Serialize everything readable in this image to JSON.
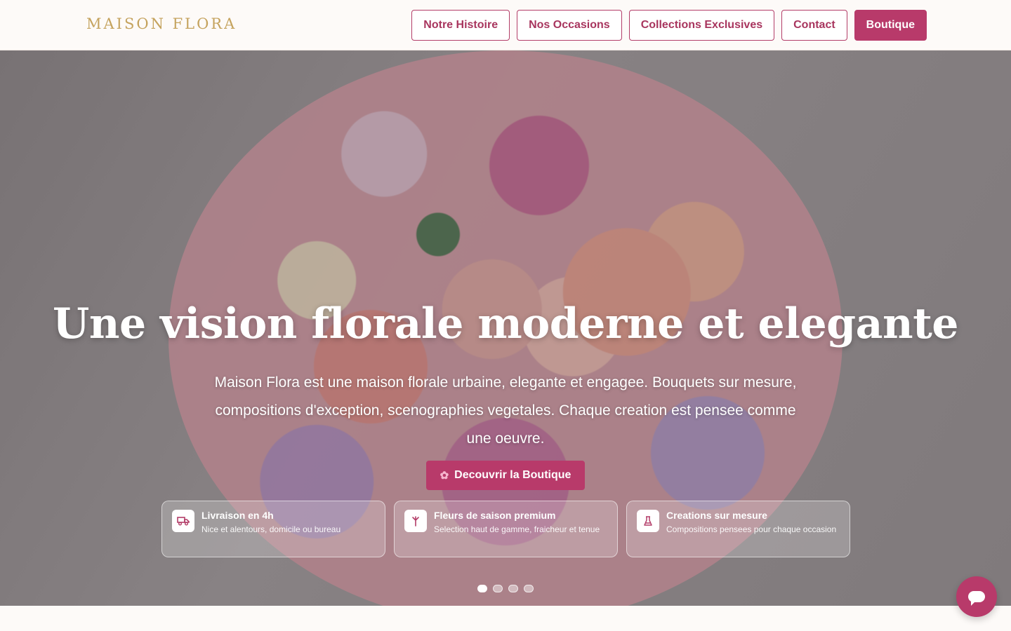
{
  "header": {
    "logo": "MAISON FLORA",
    "nav": [
      {
        "label": "Notre Histoire"
      },
      {
        "label": "Nos Occasions"
      },
      {
        "label": "Collections Exclusives"
      },
      {
        "label": "Contact"
      },
      {
        "label": "Boutique",
        "primary": true
      }
    ]
  },
  "hero": {
    "title": "Une vision florale moderne et elegante",
    "subtitle": "Maison Flora est une maison florale urbaine, elegante et engagee. Bouquets sur mesure, compositions d'exception, scenographies vegetales. Chaque creation est pensee comme une oeuvre.",
    "cta_label": "Decouvrir la Boutique",
    "cta_icon": "flower-icon",
    "features": [
      {
        "icon": "truck-icon",
        "title": "Livraison en 4h",
        "desc": "Nice et alentours, domicile ou bureau"
      },
      {
        "icon": "flower-stem-icon",
        "title": "Fleurs de saison premium",
        "desc": "Selection haut de gamme, fraicheur et tenue"
      },
      {
        "icon": "flask-icon",
        "title": "Creations sur mesure",
        "desc": "Compositions pensees pour chaque occasion"
      }
    ],
    "slides": {
      "count": 4,
      "active": 1
    }
  },
  "colors": {
    "accent": "#b83a6a",
    "gold": "#c5a35e",
    "background": "#fdfaf8"
  },
  "chat_icon": "chat-icon"
}
